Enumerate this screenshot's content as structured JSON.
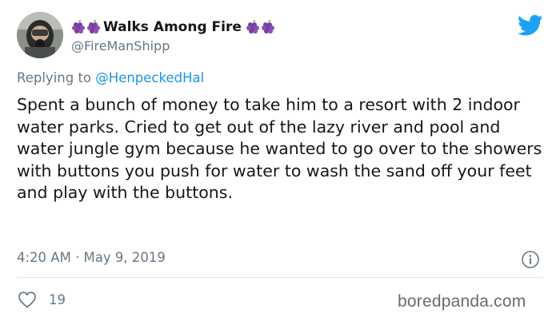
{
  "tweet": {
    "display_name": "Walks Among Fire",
    "name_emoji_icons": [
      "grapes-icon",
      "grapes-icon"
    ],
    "handle": "@FireManShipp",
    "reply_prefix": "Replying to",
    "reply_to": "@HenpeckedHal",
    "text": "Spent a bunch of money to take him to a resort with 2 indoor water parks. Cried to get out of the lazy river and pool and water jungle gym because he wanted to go over to the showers with buttons you push for water to wash the sand off your feet and play with the buttons.",
    "timestamp": "4:20 AM · May 9, 2019",
    "like_count": "19"
  },
  "branding": {
    "platform_icon": "twitter-bird-icon",
    "watermark": "boredpanda.com"
  },
  "colors": {
    "text": "#14171a",
    "secondary": "#657786",
    "link": "#1b95e0",
    "twitter_blue": "#1da1f2",
    "divider": "#e1e8ed",
    "grape": "#7b3fa0"
  }
}
